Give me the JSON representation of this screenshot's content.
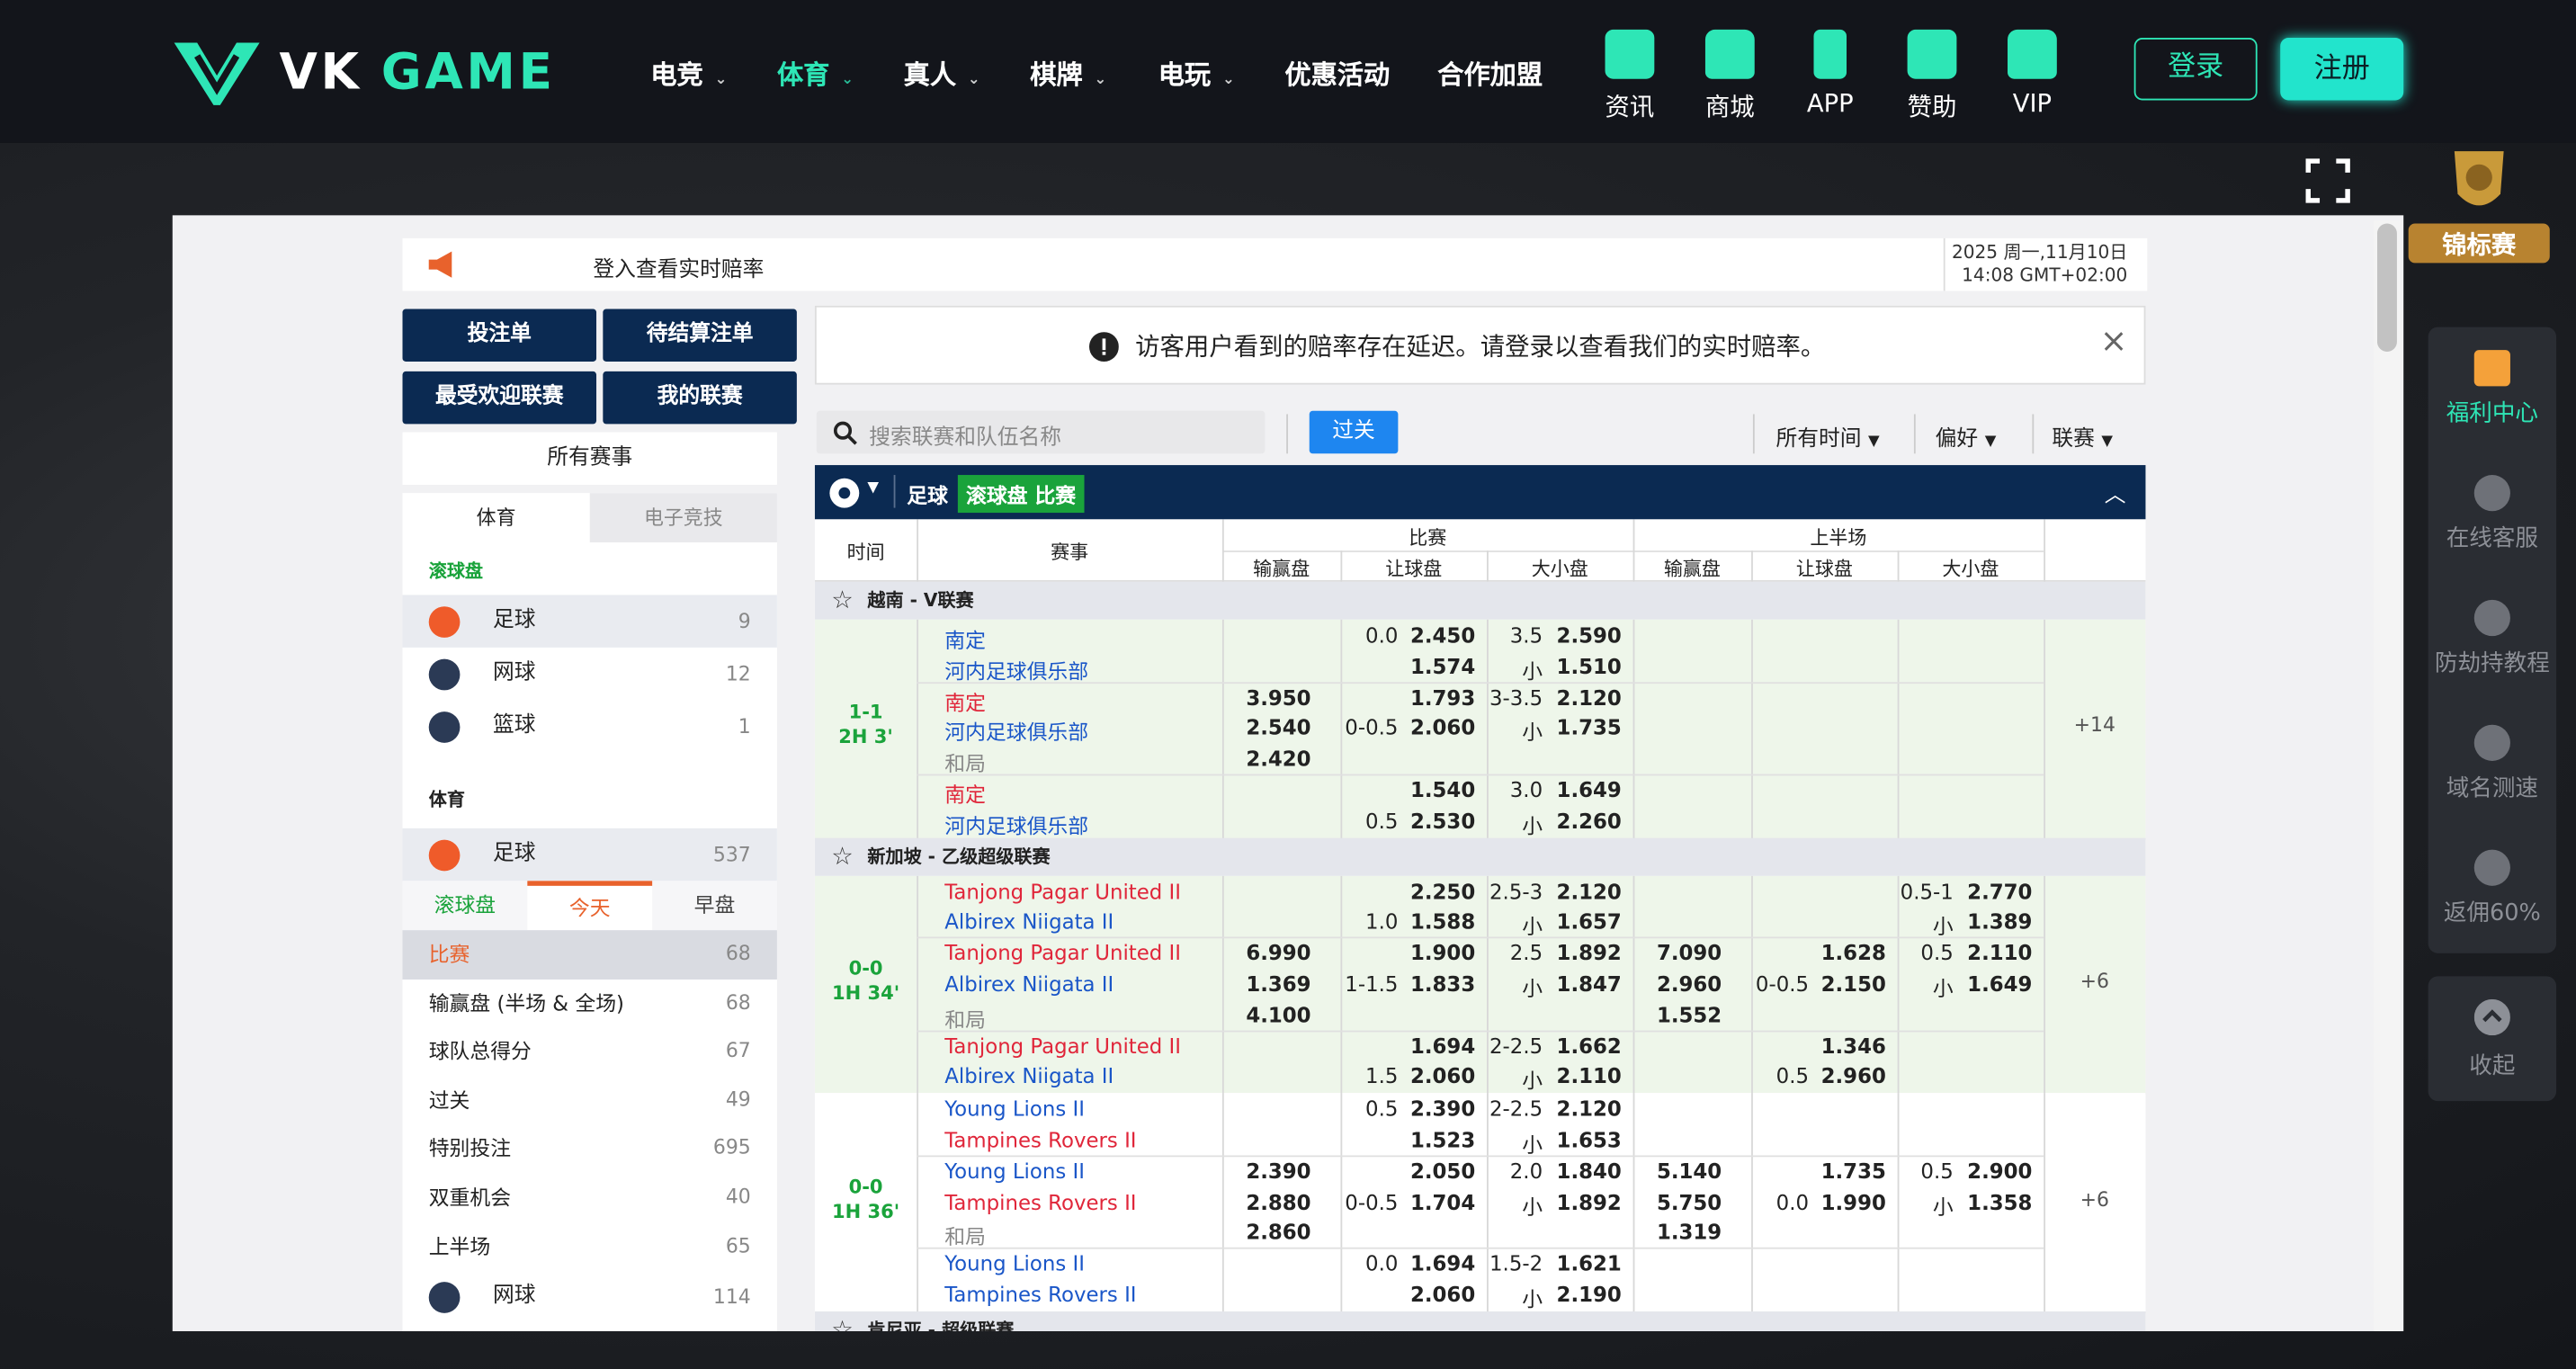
{
  "header": {
    "nav": [
      {
        "label": "电竞",
        "caret": true
      },
      {
        "label": "体育",
        "caret": true,
        "active": true
      },
      {
        "label": "真人",
        "caret": true
      },
      {
        "label": "棋牌",
        "caret": true
      },
      {
        "label": "电玩",
        "caret": true
      },
      {
        "label": "优惠活动"
      },
      {
        "label": "合作加盟"
      }
    ],
    "tools": [
      "资讯",
      "商城",
      "APP",
      "赞助",
      "VIP"
    ],
    "login": "登录",
    "register": "注册",
    "caret": "⌄"
  },
  "banner": {
    "message": "登入查看实时赔率",
    "date_line1": "2025 周一,11月10日",
    "date_line2": "14:08 GMT+02:00"
  },
  "left": {
    "buttons": [
      "投注单",
      "待结算注单",
      "最受欢迎联赛",
      "我的联赛"
    ],
    "all_events": "所有赛事",
    "tabs": [
      "体育",
      "电子竞技"
    ],
    "live_title": "滚球盘",
    "live": [
      {
        "name": "足球",
        "count": "9"
      },
      {
        "name": "网球",
        "count": "12"
      },
      {
        "name": "篮球",
        "count": "1"
      }
    ],
    "sports_title": "体育",
    "sport": {
      "name": "足球",
      "count": "537"
    },
    "subtabs": [
      "滚球盘",
      "今天",
      "早盘"
    ],
    "markets": [
      {
        "name": "比赛",
        "count": "68"
      },
      {
        "name": "输赢盘 (半场 & 全场)",
        "count": "68"
      },
      {
        "name": "球队总得分",
        "count": "67"
      },
      {
        "name": "过关",
        "count": "49"
      },
      {
        "name": "特别投注",
        "count": "695"
      },
      {
        "name": "双重机会",
        "count": "40"
      },
      {
        "name": "上半场",
        "count": "65"
      }
    ],
    "tennis": {
      "name": "网球",
      "count": "114"
    }
  },
  "notice": "访客用户看到的赔率存在延迟。请登录以查看我们的实时赔率。",
  "search_placeholder": "搜索联赛和队伍名称",
  "parlay": "过关",
  "filters": [
    "所有时间",
    "偏好",
    "联赛"
  ],
  "section": {
    "sport": "足球",
    "badge": "滚球盘 比赛"
  },
  "table_head": {
    "time": "时间",
    "event": "赛事",
    "full": "比赛",
    "half": "上半场",
    "cols": [
      "输赢盘",
      "让球盘",
      "大小盘",
      "输赢盘",
      "让球盘",
      "大小盘"
    ]
  },
  "leagues": [
    {
      "name": "越南 - V联赛",
      "matches": [
        {
          "score": "1-1",
          "clock": "2H 3'",
          "more": "+14",
          "green": true,
          "groups": [
            {
              "home": "南定",
              "away": "河内足球俱乐部",
              "hline": "0.0",
              "h1": "2.450",
              "h2": "1.574",
              "tline": "3.5",
              "t1": "2.590",
              "t2": "1.510",
              "under": "小",
              "homeRed": false
            },
            {
              "home": "南定",
              "away": "河内足球俱乐部",
              "draw": "和局",
              "x1": "3.950",
              "x2": "2.540",
              "x3": "2.420",
              "hline": "0-0.5",
              "h1": "1.793",
              "h2": "2.060",
              "tline": "3-3.5",
              "t1": "2.120",
              "t2": "1.735",
              "under": "小",
              "homeRed": true
            },
            {
              "home": "南定",
              "away": "河内足球俱乐部",
              "hline": "0.5",
              "h1": "1.540",
              "h2": "2.530",
              "tline": "3.0",
              "t1": "1.649",
              "t2": "2.260",
              "under": "小",
              "homeRed": true,
              "hline_row": 2
            }
          ]
        }
      ]
    },
    {
      "name": "新加坡 - 乙级超级联赛",
      "matches": [
        {
          "score": "0-0",
          "clock": "1H 34'",
          "more": "+6",
          "green": true,
          "groups": [
            {
              "home": "Tanjong Pagar United II",
              "away": "Albirex Niigata II",
              "hline": "1.0",
              "h1": "2.250",
              "h2": "1.588",
              "tline": "2.5-3",
              "t1": "2.120",
              "t2": "1.657",
              "under": "小",
              "homeRed": true,
              "hline_row": 2,
              "htline": "0.5-1",
              "ht1": "2.770",
              "ht2": "1.389"
            },
            {
              "home": "Tanjong Pagar United II",
              "away": "Albirex Niigata II",
              "draw": "和局",
              "x1": "6.990",
              "x2": "1.369",
              "x3": "4.100",
              "hline": "1-1.5",
              "h1": "1.900",
              "h2": "1.833",
              "tline": "2.5",
              "t1": "1.892",
              "t2": "1.847",
              "under": "小",
              "homeRed": true,
              "hx1": "7.090",
              "hx2": "2.960",
              "hx3": "1.552",
              "hhline": "0-0.5",
              "hh1": "1.628",
              "hh2": "2.150",
              "htline": "0.5",
              "ht1": "2.110",
              "ht2": "1.649"
            },
            {
              "home": "Tanjong Pagar United II",
              "away": "Albirex Niigata II",
              "hline": "1.5",
              "h1": "1.694",
              "h2": "2.060",
              "tline": "2-2.5",
              "t1": "1.662",
              "t2": "2.110",
              "under": "小",
              "homeRed": true,
              "hline_row": 2,
              "hhline": "0.5",
              "hh1": "1.346",
              "hh2": "2.960",
              "hhline_row": 2
            }
          ]
        },
        {
          "score": "0-0",
          "clock": "1H 36'",
          "more": "+6",
          "green": false,
          "groups": [
            {
              "home": "Young Lions II",
              "away": "Tampines Rovers II",
              "hline": "0.5",
              "h1": "2.390",
              "h2": "1.523",
              "tline": "2-2.5",
              "t1": "2.120",
              "t2": "1.653",
              "under": "小",
              "homeRed": false,
              "awayRed": true
            },
            {
              "home": "Young Lions II",
              "away": "Tampines Rovers II",
              "draw": "和局",
              "x1": "2.390",
              "x2": "2.880",
              "x3": "2.860",
              "hline": "0-0.5",
              "h1": "2.050",
              "h2": "1.704",
              "tline": "2.0",
              "t1": "1.840",
              "t2": "1.892",
              "under": "小",
              "homeRed": false,
              "awayRed": true,
              "hx1": "5.140",
              "hx2": "5.750",
              "hx3": "1.319",
              "hhline": "0.0",
              "hh1": "1.735",
              "hh2": "1.990",
              "htline": "0.5",
              "ht1": "2.900",
              "ht2": "1.358"
            },
            {
              "home": "Young Lions II",
              "away": "Tampines Rovers II",
              "hline": "0.0",
              "h1": "1.694",
              "h2": "2.060",
              "tline": "1.5-2",
              "t1": "1.621",
              "t2": "2.190",
              "under": "小",
              "homeRed": false,
              "awayRed": false
            }
          ]
        }
      ]
    },
    {
      "name": "肯尼亚 - 超级联赛",
      "matches": []
    }
  ],
  "side": [
    "福利中心",
    "在线客服",
    "防劫持教程",
    "域名测速",
    "返佣60%"
  ],
  "collapse": "收起",
  "trophy": "锦标赛",
  "colors": {
    "accent": "#2ee6b6",
    "navy": "#0b2a52",
    "red": "#e0263a",
    "blue": "#1a56c8",
    "green": "#1aa33b"
  }
}
